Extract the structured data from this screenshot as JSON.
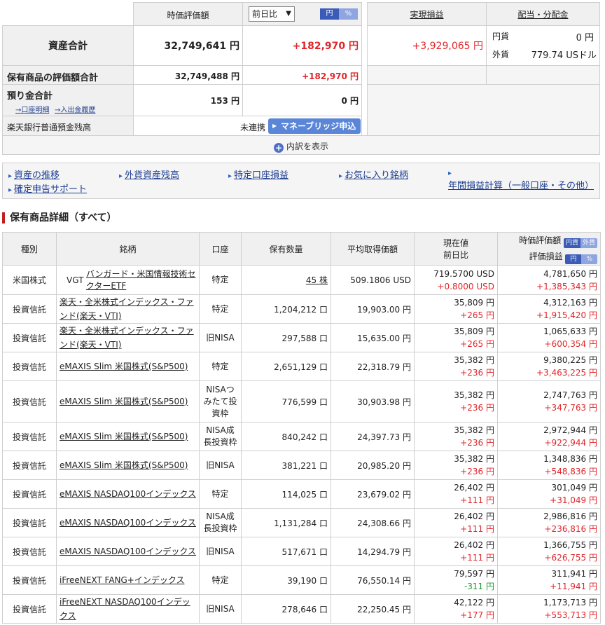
{
  "summary": {
    "col_valuation": "時価評価額",
    "compare_select": "前日比",
    "toggle_yen": "円",
    "toggle_pct": "%",
    "col_realized": "実現損益",
    "col_dividend": "配当・分配金",
    "total_label": "資産合計",
    "total_value": "32,749,641 円",
    "total_change": "+182,970 円",
    "realized_value": "+3,929,065 円",
    "div_jpy_label": "円貨",
    "div_jpy_value": "0 円",
    "div_fx_label": "外貨",
    "div_fx_value": "779.74 USドル",
    "holdings_label": "保有商品の評価額合計",
    "holdings_value": "32,749,488 円",
    "holdings_change": "+182,970 円",
    "deposit_label": "預り金合計",
    "deposit_value": "153 円",
    "deposit_change": "0 円",
    "link_account": "→口座明細",
    "link_history": "→入出金履歴",
    "rakuten_label": "楽天銀行普通預金残高",
    "rakuten_status": "未連携",
    "moneybridge_button": "マネーブリッジ申込",
    "show_breakdown": "内訳を表示"
  },
  "links": [
    "資産の推移",
    "外貨資産残高",
    "特定口座損益",
    "お気に入り銘柄",
    "年間損益計算（一般口座・その他）",
    "確定申告サポート"
  ],
  "detail": {
    "section_title": "保有商品詳細（すべて）",
    "headers": {
      "type": "種別",
      "name": "銘柄",
      "account": "口座",
      "qty": "保有数量",
      "avg": "平均取得価額",
      "price1": "現在値",
      "price2": "前日比",
      "val1": "時価評価額",
      "val2": "評価損益",
      "tg_jpy": "円貨",
      "tg_fx": "外貨",
      "tg_yen": "円",
      "tg_pct": "%"
    },
    "rows": [
      {
        "type": "米国株式",
        "ticker": "VGT",
        "name": "バンガード・米国情報技術セクターETF",
        "account": "特定",
        "qty": "45 株",
        "avg": "509.1806 USD",
        "price": "719.5700 USD",
        "change": "+0.8000 USD",
        "value": "4,781,650 円",
        "pl": "+1,385,343 円"
      },
      {
        "type": "投資信託",
        "ticker": "",
        "name": "楽天・全米株式インデックス・ファンド(楽天・VTI)",
        "account": "特定",
        "qty": "1,204,212 口",
        "avg": "19,903.00 円",
        "price": "35,809 円",
        "change": "+265 円",
        "value": "4,312,163 円",
        "pl": "+1,915,420 円"
      },
      {
        "type": "投資信託",
        "ticker": "",
        "name": "楽天・全米株式インデックス・ファンド(楽天・VTI)",
        "account": "旧NISA",
        "qty": "297,588 口",
        "avg": "15,635.00 円",
        "price": "35,809 円",
        "change": "+265 円",
        "value": "1,065,633 円",
        "pl": "+600,354 円"
      },
      {
        "type": "投資信託",
        "ticker": "",
        "name": "eMAXIS Slim 米国株式(S&P500)",
        "account": "特定",
        "qty": "2,651,129 口",
        "avg": "22,318.79 円",
        "price": "35,382 円",
        "change": "+236 円",
        "value": "9,380,225 円",
        "pl": "+3,463,225 円"
      },
      {
        "type": "投資信託",
        "ticker": "",
        "name": "eMAXIS Slim 米国株式(S&P500)",
        "account": "NISAつみたて投資枠",
        "qty": "776,599 口",
        "avg": "30,903.98 円",
        "price": "35,382 円",
        "change": "+236 円",
        "value": "2,747,763 円",
        "pl": "+347,763 円"
      },
      {
        "type": "投資信託",
        "ticker": "",
        "name": "eMAXIS Slim 米国株式(S&P500)",
        "account": "NISA成長投資枠",
        "qty": "840,242 口",
        "avg": "24,397.73 円",
        "price": "35,382 円",
        "change": "+236 円",
        "value": "2,972,944 円",
        "pl": "+922,944 円"
      },
      {
        "type": "投資信託",
        "ticker": "",
        "name": "eMAXIS Slim 米国株式(S&P500)",
        "account": "旧NISA",
        "qty": "381,221 口",
        "avg": "20,985.20 円",
        "price": "35,382 円",
        "change": "+236 円",
        "value": "1,348,836 円",
        "pl": "+548,836 円"
      },
      {
        "type": "投資信託",
        "ticker": "",
        "name": "eMAXIS NASDAQ100インデックス",
        "account": "特定",
        "qty": "114,025 口",
        "avg": "23,679.02 円",
        "price": "26,402 円",
        "change": "+111 円",
        "value": "301,049 円",
        "pl": "+31,049 円"
      },
      {
        "type": "投資信託",
        "ticker": "",
        "name": "eMAXIS NASDAQ100インデックス",
        "account": "NISA成長投資枠",
        "qty": "1,131,284 口",
        "avg": "24,308.66 円",
        "price": "26,402 円",
        "change": "+111 円",
        "value": "2,986,816 円",
        "pl": "+236,816 円"
      },
      {
        "type": "投資信託",
        "ticker": "",
        "name": "eMAXIS NASDAQ100インデックス",
        "account": "旧NISA",
        "qty": "517,671 口",
        "avg": "14,294.79 円",
        "price": "26,402 円",
        "change": "+111 円",
        "value": "1,366,755 円",
        "pl": "+626,755 円"
      },
      {
        "type": "投資信託",
        "ticker": "",
        "name": "iFreeNEXT FANG+インデックス",
        "account": "特定",
        "qty": "39,190 口",
        "avg": "76,550.14 円",
        "price": "79,597 円",
        "change": "-311 円",
        "value": "311,941 円",
        "pl": "+11,941 円"
      },
      {
        "type": "投資信託",
        "ticker": "",
        "name": "iFreeNEXT NASDAQ100インデックス",
        "account": "旧NISA",
        "qty": "278,646 口",
        "avg": "22,250.45 円",
        "price": "42,122 円",
        "change": "+177 円",
        "value": "1,173,713 円",
        "pl": "+553,713 円"
      }
    ]
  },
  "colors": {
    "positive": "#e0262b",
    "negative": "#1e9a2f",
    "accent": "#5b86d8",
    "link": "#1d3d8f"
  }
}
